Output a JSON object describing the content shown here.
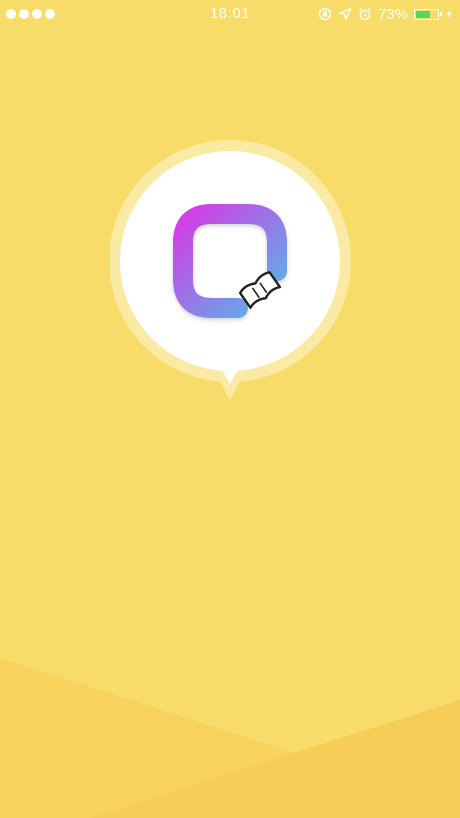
{
  "status_bar": {
    "time": "18:01",
    "battery_percent_label": "73%",
    "battery_level": 0.73,
    "signal_dots": 4,
    "icons": [
      "signal-dots-icon",
      "screen-rotation-lock-icon",
      "location-arrow-icon",
      "alarm-clock-icon",
      "battery-icon",
      "charging-bolt-icon"
    ]
  },
  "colors": {
    "background": "#f8dc6a",
    "wave_dark": "#f6cd56",
    "wave_mid": "#f7d35e",
    "bubble_halo": "#fbeaa4",
    "bubble": "#ffffff",
    "logo_gradient_start": "#d73ce6",
    "logo_gradient_end": "#55b6e8",
    "battery_fill": "#4cd964"
  },
  "splash": {
    "logo_icon": "app-logo-ring-with-book-icon"
  }
}
